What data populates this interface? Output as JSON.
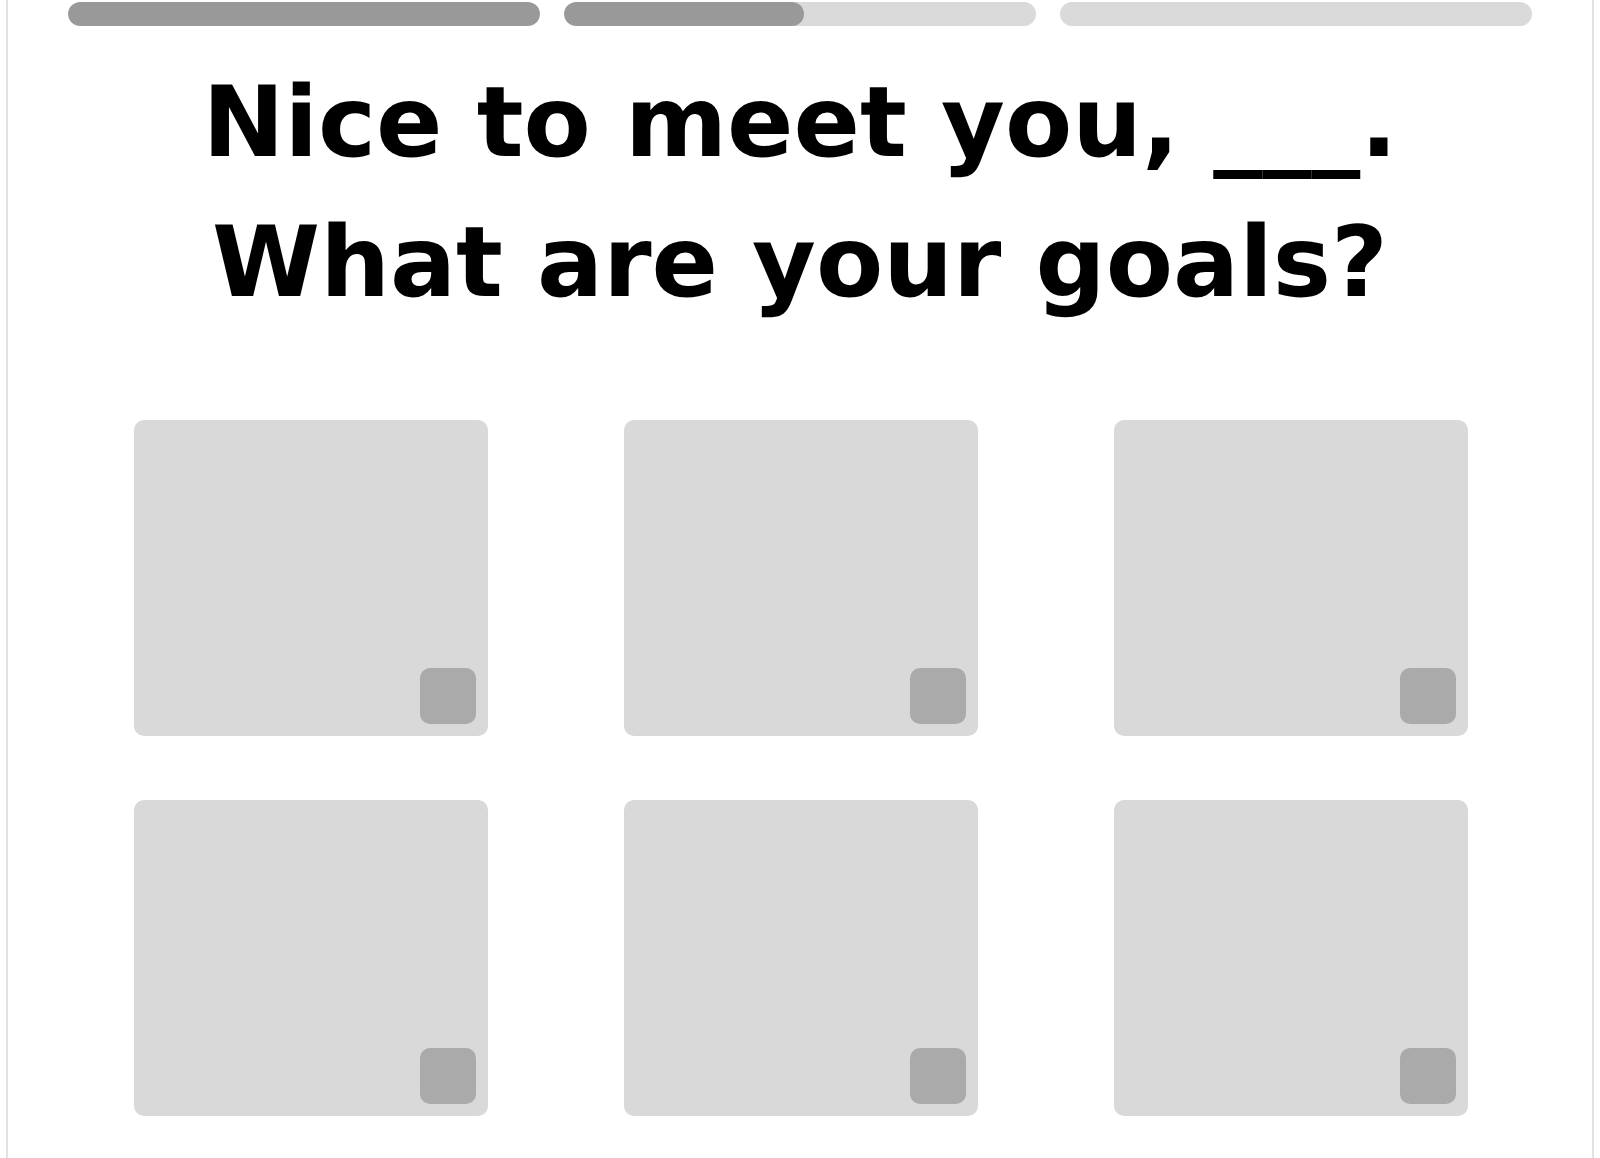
{
  "progress": [
    {
      "level": 1
    },
    {
      "level": 0.51
    },
    {
      "level": 0
    }
  ],
  "heading": [
    "Nice to meet you, ___.",
    "What are your goals?"
  ],
  "goals": [
    {
      "checked": false
    },
    {
      "checked": false
    },
    {
      "checked": false
    },
    {
      "checked": false
    },
    {
      "checked": false
    },
    {
      "checked": false
    }
  ]
}
